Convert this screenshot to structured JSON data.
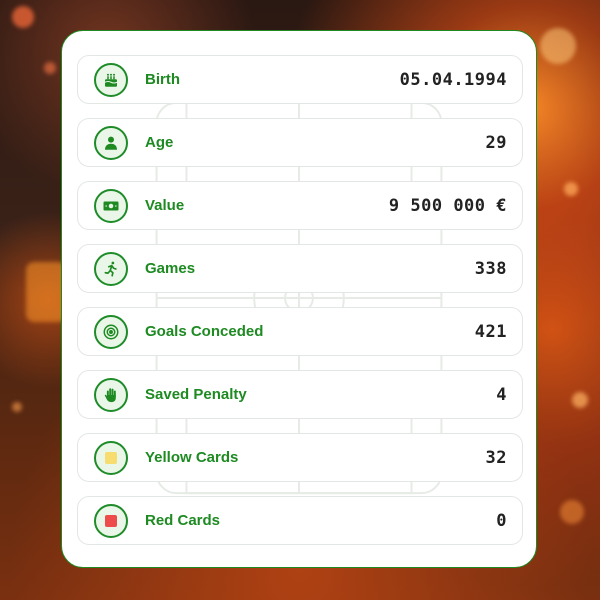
{
  "stats": [
    {
      "label": "Birth",
      "value": "05.04.1994",
      "icon": "birthday-cake-icon"
    },
    {
      "label": "Age",
      "value": "29",
      "icon": "person-icon"
    },
    {
      "label": "Value",
      "value": "9 500 000 €",
      "icon": "banknote-icon"
    },
    {
      "label": "Games",
      "value": "338",
      "icon": "running-person-icon"
    },
    {
      "label": "Goals Conceded",
      "value": "421",
      "icon": "target-icon"
    },
    {
      "label": "Saved Penalty",
      "value": "4",
      "icon": "hand-icon"
    },
    {
      "label": "Yellow Cards",
      "value": "32",
      "icon": "yellow-card-icon"
    },
    {
      "label": "Red Cards",
      "value": "0",
      "icon": "red-card-icon"
    }
  ],
  "colors": {
    "accent": "#1e8a22",
    "icon_bg": "#eaf6e8",
    "yellow_card": "#f7dc6f",
    "red_card": "#ee4b4b",
    "value_text": "#222222"
  }
}
